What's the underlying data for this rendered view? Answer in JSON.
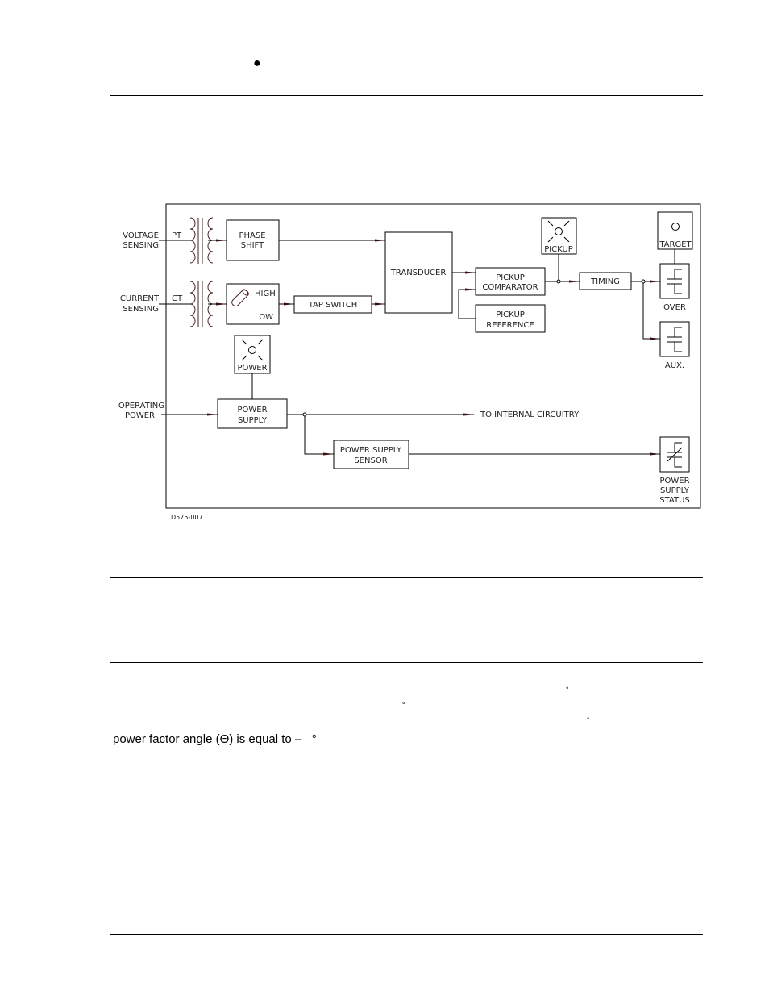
{
  "page": {
    "bullet": "●",
    "figure_id": "D575-007",
    "body_line": "power factor angle (Θ) is equal to –   °",
    "degree_marks": [
      "°",
      "°",
      "°"
    ]
  },
  "diagram": {
    "inputs": {
      "voltage": [
        "VOLTAGE",
        "SENSING"
      ],
      "current": [
        "CURRENT",
        "SENSING"
      ],
      "operating": [
        "OPERATING",
        "POWER"
      ]
    },
    "transformers": {
      "pt": "PT",
      "ct": "CT"
    },
    "blocks": {
      "phase_shift": [
        "PHASE",
        "SHIFT"
      ],
      "high": "HIGH",
      "low": "LOW",
      "tap_switch": "TAP  SWITCH",
      "transducer": "TRANSDUCER",
      "pickup_comparator": [
        "PICKUP",
        "COMPARATOR"
      ],
      "pickup_reference": [
        "PICKUP",
        "REFERENCE"
      ],
      "timing": "TIMING",
      "power_supply": [
        "POWER",
        "SUPPLY"
      ],
      "power_supply_sensor": [
        "POWER  SUPPLY",
        "SENSOR"
      ]
    },
    "indicators": {
      "pickup": "PICKUP",
      "target": "TARGET",
      "power": "POWER"
    },
    "outputs": {
      "over": "OVER",
      "aux": "AUX.",
      "power_supply_status": [
        "POWER",
        "SUPPLY",
        "STATUS"
      ],
      "internal": "TO  INTERNAL  CIRCUITRY"
    },
    "colors": {
      "arrow": "#3a1010",
      "line": "#000000",
      "coil": "#4a2020"
    }
  }
}
